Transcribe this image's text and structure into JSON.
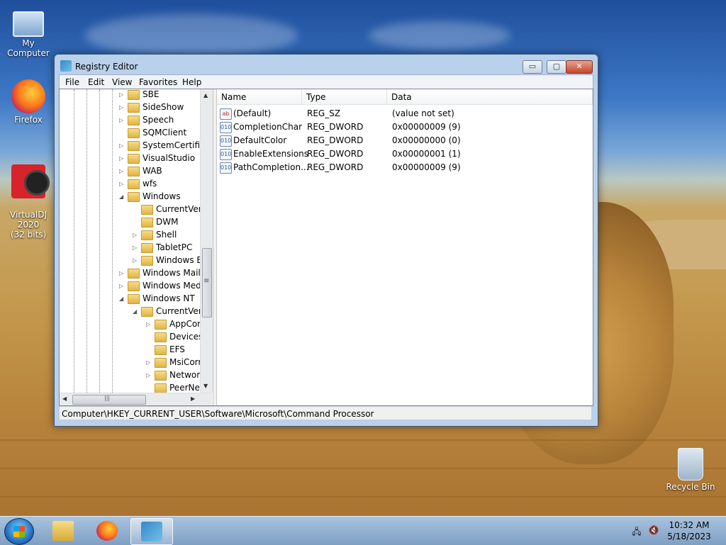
{
  "desktop": {
    "icons": [
      {
        "label": "My Computer"
      },
      {
        "label": "Firefox"
      },
      {
        "label": "VirtualDJ 2020\n(32 bits)"
      },
      {
        "label": "Recycle Bin"
      }
    ]
  },
  "window": {
    "title": "Registry Editor",
    "controls": {
      "minimize": "▭",
      "maximize": "▢",
      "close": "✕"
    },
    "menu": [
      "File",
      "Edit",
      "View",
      "Favorites",
      "Help"
    ],
    "tree": [
      {
        "label": "SBE",
        "expander": "▷",
        "level": 0
      },
      {
        "label": "SideShow",
        "expander": "▷",
        "level": 0
      },
      {
        "label": "Speech",
        "expander": "▷",
        "level": 0
      },
      {
        "label": "SQMClient",
        "expander": "",
        "level": 0
      },
      {
        "label": "SystemCertificates",
        "expander": "▷",
        "level": 0
      },
      {
        "label": "VisualStudio",
        "expander": "▷",
        "level": 0
      },
      {
        "label": "WAB",
        "expander": "▷",
        "level": 0
      },
      {
        "label": "wfs",
        "expander": "▷",
        "level": 0
      },
      {
        "label": "Windows",
        "expander": "◢",
        "level": 0
      },
      {
        "label": "CurrentVersion",
        "expander": "",
        "level": 1
      },
      {
        "label": "DWM",
        "expander": "",
        "level": 1
      },
      {
        "label": "Shell",
        "expander": "▷",
        "level": 1
      },
      {
        "label": "TabletPC",
        "expander": "▷",
        "level": 1
      },
      {
        "label": "Windows Error Reporting",
        "expander": "▷",
        "level": 1
      },
      {
        "label": "Windows Mail",
        "expander": "▷",
        "level": 0
      },
      {
        "label": "Windows Media",
        "expander": "▷",
        "level": 0
      },
      {
        "label": "Windows NT",
        "expander": "◢",
        "level": 0
      },
      {
        "label": "CurrentVersion",
        "expander": "◢",
        "level": 1
      },
      {
        "label": "AppCompatFlags",
        "expander": "▷",
        "level": 2
      },
      {
        "label": "Devices",
        "expander": "",
        "level": 2
      },
      {
        "label": "EFS",
        "expander": "",
        "level": 2
      },
      {
        "label": "MsiCorruptedFileRecovery",
        "expander": "▷",
        "level": 2
      },
      {
        "label": "Network",
        "expander": "▷",
        "level": 2
      },
      {
        "label": "PeerNet",
        "expander": "",
        "level": 2
      }
    ],
    "columns": [
      "Name",
      "Type",
      "Data"
    ],
    "values": [
      {
        "name": "(Default)",
        "type": "REG_SZ",
        "data": "(value not set)",
        "icon": "ab"
      },
      {
        "name": "CompletionChar",
        "type": "REG_DWORD",
        "data": "0x00000009 (9)",
        "icon": "010"
      },
      {
        "name": "DefaultColor",
        "type": "REG_DWORD",
        "data": "0x00000000 (0)",
        "icon": "010"
      },
      {
        "name": "EnableExtensions",
        "type": "REG_DWORD",
        "data": "0x00000001 (1)",
        "icon": "010"
      },
      {
        "name": "PathCompletion...",
        "type": "REG_DWORD",
        "data": "0x00000009 (9)",
        "icon": "010"
      }
    ],
    "status": "Computer\\HKEY_CURRENT_USER\\Software\\Microsoft\\Command Processor",
    "scroll": {
      "up": "▲",
      "down": "▼",
      "left": "◀",
      "right": "▶",
      "hgrip": "|||",
      "vgrip": "≡"
    }
  },
  "taskbar": {
    "time": "10:32 AM",
    "date": "5/18/2023",
    "tray": {
      "network": "🖧",
      "volume": "🔇"
    }
  }
}
